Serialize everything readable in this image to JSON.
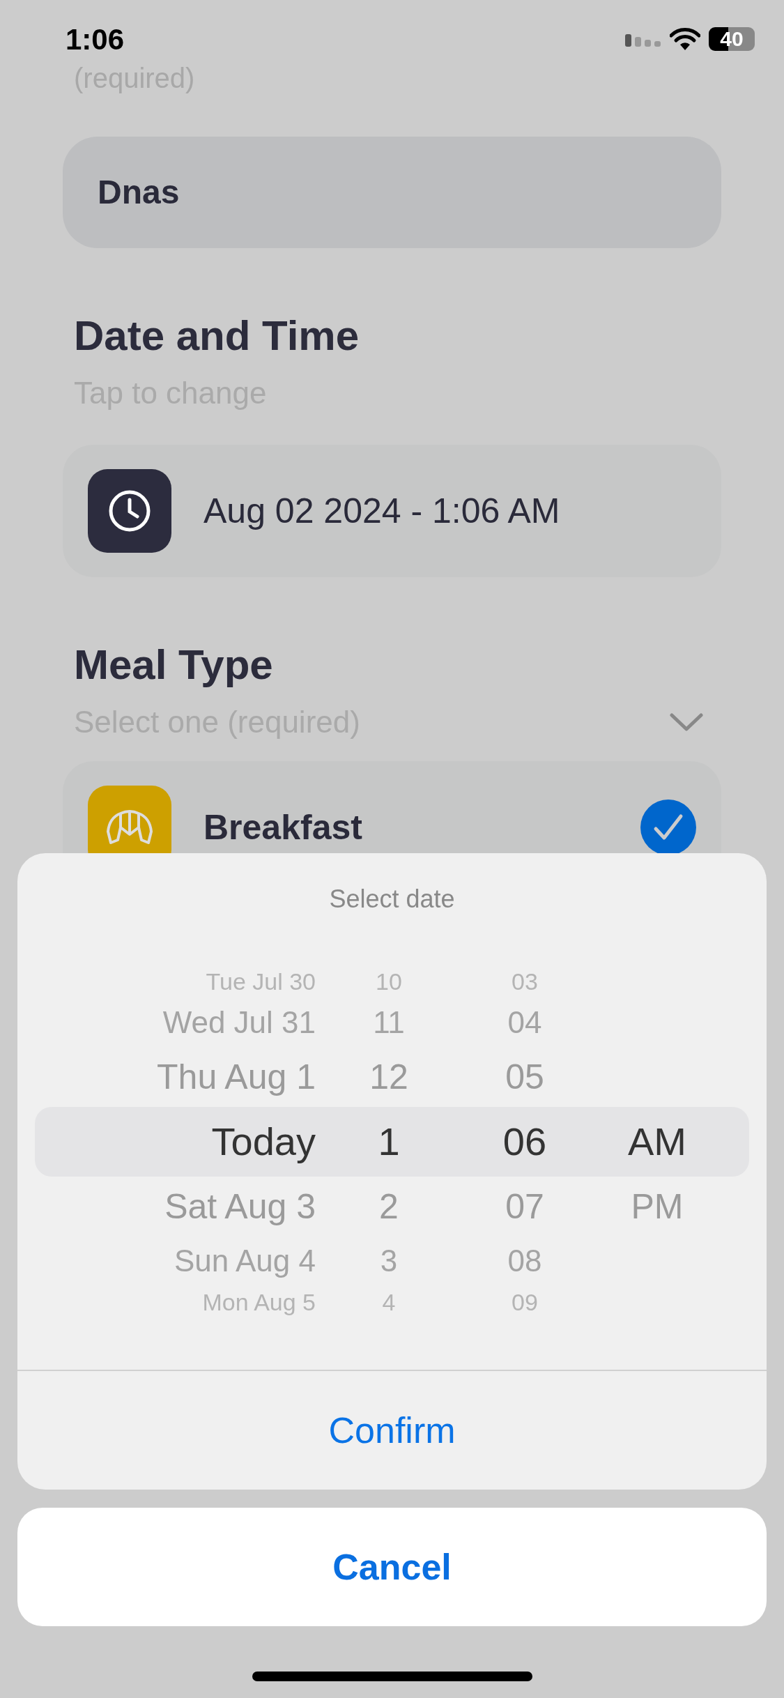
{
  "status_bar": {
    "time": "1:06",
    "battery": "40"
  },
  "name_field": {
    "hint": "(required)",
    "value": "Dnas"
  },
  "date_time": {
    "title": "Date and Time",
    "subtitle": "Tap to change",
    "value": "Aug 02 2024 - 1:06 AM"
  },
  "meal_type": {
    "title": "Meal Type",
    "subtitle": "Select one (required)",
    "options": [
      {
        "label": "Breakfast",
        "checked": true
      }
    ]
  },
  "picker": {
    "title": "Select date",
    "columns": [
      {
        "kind": "date",
        "items": [
          {
            "label": "Tue Jul 30",
            "selected": false
          },
          {
            "label": "Wed Jul 31",
            "selected": false
          },
          {
            "label": "Thu Aug 1",
            "selected": false
          },
          {
            "label": "Today",
            "selected": true
          },
          {
            "label": "Sat Aug 3",
            "selected": false
          },
          {
            "label": "Sun Aug 4",
            "selected": false
          },
          {
            "label": "Mon Aug 5",
            "selected": false
          }
        ]
      },
      {
        "kind": "hour",
        "items": [
          {
            "label": "10",
            "selected": false
          },
          {
            "label": "11",
            "selected": false
          },
          {
            "label": "12",
            "selected": false
          },
          {
            "label": "1",
            "selected": true
          },
          {
            "label": "2",
            "selected": false
          },
          {
            "label": "3",
            "selected": false
          },
          {
            "label": "4",
            "selected": false
          }
        ]
      },
      {
        "kind": "minute",
        "items": [
          {
            "label": "03",
            "selected": false
          },
          {
            "label": "04",
            "selected": false
          },
          {
            "label": "05",
            "selected": false
          },
          {
            "label": "06",
            "selected": true
          },
          {
            "label": "07",
            "selected": false
          },
          {
            "label": "08",
            "selected": false
          },
          {
            "label": "09",
            "selected": false
          }
        ]
      },
      {
        "kind": "ampm",
        "items": [
          {
            "label": "AM",
            "selected": true
          },
          {
            "label": "PM",
            "selected": false
          }
        ]
      }
    ],
    "confirm": "Confirm"
  },
  "cancel": "Cancel"
}
